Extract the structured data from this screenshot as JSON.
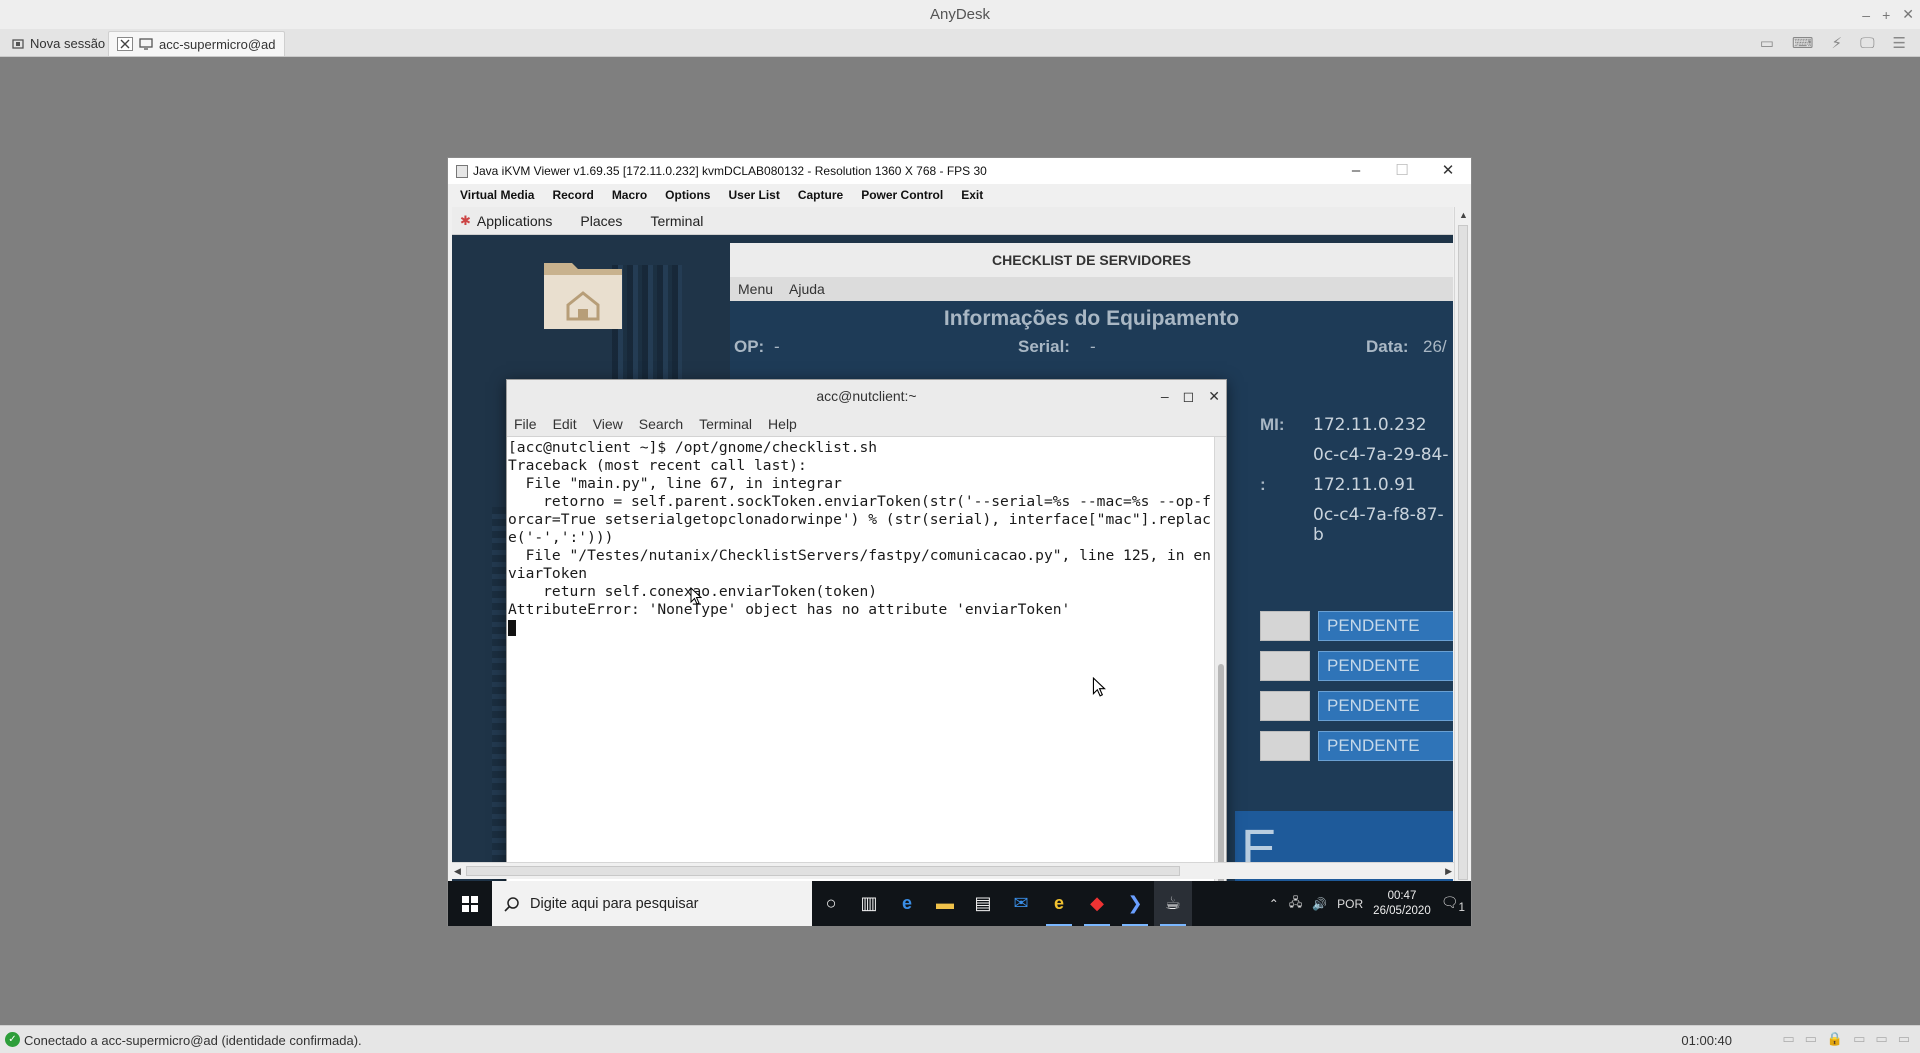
{
  "anydesk": {
    "title": "AnyDesk",
    "window_controls": [
      "–",
      "+",
      "✕"
    ],
    "tabs": {
      "new_session": "Nova sessão",
      "connection": "acc-supermicro@ad"
    },
    "status_text": "Conectado a acc-supermicro@ad (identidade confirmada).",
    "session_time": "01:00:40"
  },
  "kvm": {
    "title": "Java iKVM Viewer v1.69.35 [172.11.0.232] kvmDCLAB080132 - Resolution 1360 X 768 - FPS 30",
    "menu": [
      "Virtual Media",
      "Record",
      "Macro",
      "Options",
      "User List",
      "Capture",
      "Power Control",
      "Exit"
    ]
  },
  "gnome": {
    "applications": "Applications",
    "places": "Places",
    "terminal": "Terminal"
  },
  "checklist": {
    "title": "CHECKLIST DE SERVIDORES",
    "menu": [
      "Menu",
      "Ajuda"
    ],
    "heading": "Informações do Equipamento",
    "op_label": "OP:",
    "op_value": "-",
    "serial_label": "Serial:",
    "serial_value": "-",
    "data_label": "Data:",
    "data_value": "26/",
    "ipmi_label": "MI:",
    "ipmi_ip": "172.11.0.232",
    "ipmi_mac": "0c-c4-7a-29-84-",
    "host_label": ":",
    "host_ip": "172.11.0.91",
    "host_mac": "0c-c4-7a-f8-87-b",
    "pending": [
      "PENDENTE",
      "PENDENTE",
      "PENDENTE",
      "PENDENTE"
    ],
    "big_letter": "E",
    "dialog_close": "✕"
  },
  "terminal": {
    "title": "acc@nutclient:~",
    "menu": [
      "File",
      "Edit",
      "View",
      "Search",
      "Terminal",
      "Help"
    ],
    "lines": [
      "[acc@nutclient ~]$ /opt/gnome/checklist.sh",
      "Traceback (most recent call last):",
      "  File \"main.py\", line 67, in integrar",
      "    retorno = self.parent.sockToken.enviarToken(str('--serial=%s --mac=%s --op-f",
      "orcar=True setserialgetopclonadorwinpe') % (str(serial), interface[\"mac\"].replac",
      "e('-',':')))",
      "  File \"/Testes/nutanix/ChecklistServers/fastpy/comunicacao.py\", line 125, in en",
      "viarToken",
      "    return self.conexao.enviarToken(token)",
      "AttributeError: 'NoneType' object has no attribute 'enviarToken'"
    ]
  },
  "taskbar": {
    "search_placeholder": "Digite aqui para pesquisar",
    "language": "POR",
    "time": "00:47",
    "date": "26/05/2020",
    "notifications": "1"
  },
  "colors": {
    "desktop_bg": "#1f3448",
    "pendente_blue": "#2f74b8",
    "taskbar_bg": "#101418",
    "status_green": "#2e9e3a"
  }
}
